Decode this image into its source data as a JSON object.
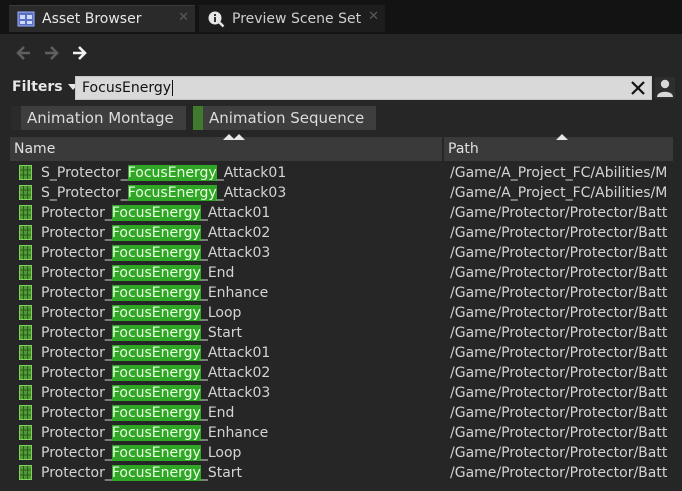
{
  "tabs": [
    {
      "label": "Asset Browser",
      "icon": "asset-browser-icon",
      "active": true
    },
    {
      "label": "Preview Scene Set",
      "icon": "preview-scene-set-icon",
      "active": false
    }
  ],
  "nav": {
    "back_icon": "arrow-left-icon",
    "forward_icon": "arrow-right-icon",
    "history_icon": "arrow-right-icon"
  },
  "filters": {
    "label": "Filters"
  },
  "search": {
    "value": "FocusEnergy"
  },
  "chips": [
    {
      "label": "Animation Montage",
      "color": "#2b2b2b"
    },
    {
      "label": "Animation Sequence",
      "color": "#3f7a2d"
    }
  ],
  "columns": {
    "name": "Name",
    "path": "Path"
  },
  "highlight_color": "#2fa626",
  "rows": [
    {
      "pre": "S_Protector_",
      "match": "FocusEnergy",
      "post": "_Attack01",
      "path": "/Game/A_Project_FC/Abilities/M"
    },
    {
      "pre": "S_Protector_",
      "match": "FocusEnergy",
      "post": "_Attack03",
      "path": "/Game/A_Project_FC/Abilities/M"
    },
    {
      "pre": "Protector_",
      "match": "FocusEnergy",
      "post": "_Attack01",
      "path": "/Game/Protector/Protector/Batt"
    },
    {
      "pre": "Protector_",
      "match": "FocusEnergy",
      "post": "_Attack02",
      "path": "/Game/Protector/Protector/Batt"
    },
    {
      "pre": "Protector_",
      "match": "FocusEnergy",
      "post": "_Attack03",
      "path": "/Game/Protector/Protector/Batt"
    },
    {
      "pre": "Protector_",
      "match": "FocusEnergy",
      "post": "_End",
      "path": "/Game/Protector/Protector/Batt"
    },
    {
      "pre": "Protector_",
      "match": "FocusEnergy",
      "post": "_Enhance",
      "path": "/Game/Protector/Protector/Batt"
    },
    {
      "pre": "Protector_",
      "match": "FocusEnergy",
      "post": "_Loop",
      "path": "/Game/Protector/Protector/Batt"
    },
    {
      "pre": "Protector_",
      "match": "FocusEnergy",
      "post": "_Start",
      "path": "/Game/Protector/Protector/Batt"
    },
    {
      "pre": "Protector_",
      "match": "FocusEnergy",
      "post": "_Attack01",
      "path": "/Game/Protector/Protector/Batt"
    },
    {
      "pre": "Protector_",
      "match": "FocusEnergy",
      "post": "_Attack02",
      "path": "/Game/Protector/Protector/Batt"
    },
    {
      "pre": "Protector_",
      "match": "FocusEnergy",
      "post": "_Attack03",
      "path": "/Game/Protector/Protector/Batt"
    },
    {
      "pre": "Protector_",
      "match": "FocusEnergy",
      "post": "_End",
      "path": "/Game/Protector/Protector/Batt"
    },
    {
      "pre": "Protector_",
      "match": "FocusEnergy",
      "post": "_Enhance",
      "path": "/Game/Protector/Protector/Batt"
    },
    {
      "pre": "Protector_",
      "match": "FocusEnergy",
      "post": "_Loop",
      "path": "/Game/Protector/Protector/Batt"
    },
    {
      "pre": "Protector_",
      "match": "FocusEnergy",
      "post": "_Start",
      "path": "/Game/Protector/Protector/Batt"
    }
  ]
}
